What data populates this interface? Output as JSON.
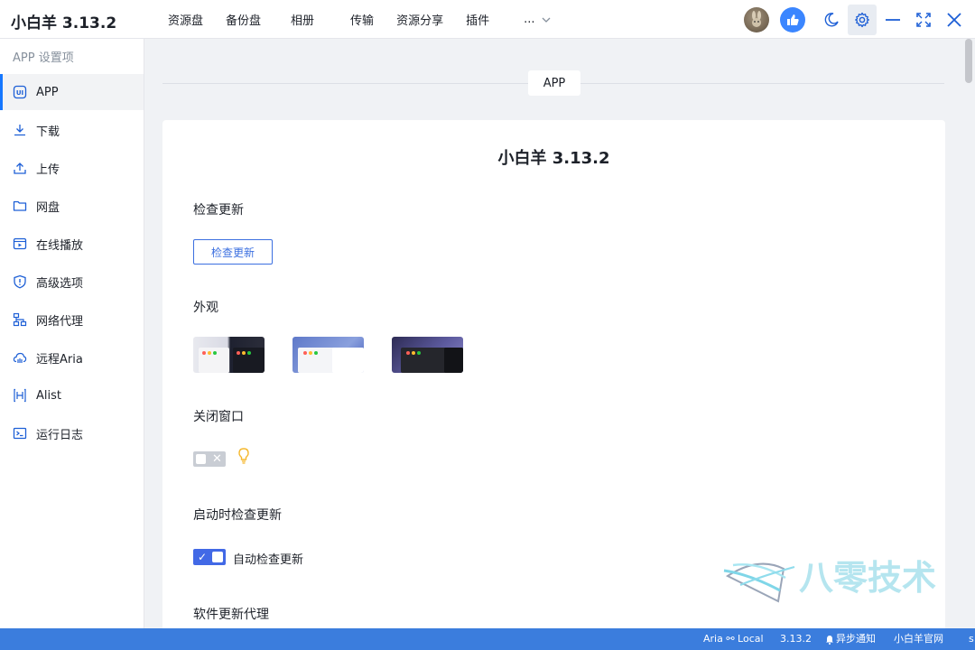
{
  "app": {
    "title": "小白羊 3.13.2"
  },
  "nav": {
    "tabs": [
      "资源盘",
      "备份盘",
      "相册",
      "传输",
      "资源分享",
      "插件"
    ],
    "more_label": "..."
  },
  "sidebar": {
    "heading": "APP 设置项",
    "items": [
      {
        "label": "APP",
        "icon": "app-icon",
        "active": true
      },
      {
        "label": "下载",
        "icon": "download-icon"
      },
      {
        "label": "上传",
        "icon": "upload-icon"
      },
      {
        "label": "网盘",
        "icon": "folder-icon"
      },
      {
        "label": "在线播放",
        "icon": "play-icon"
      },
      {
        "label": "高级选项",
        "icon": "shield-icon"
      },
      {
        "label": "网络代理",
        "icon": "network-icon"
      },
      {
        "label": "远程Aria",
        "icon": "cloud-icon"
      },
      {
        "label": "Alist",
        "icon": "alist-icon"
      },
      {
        "label": "运行日志",
        "icon": "terminal-icon"
      }
    ]
  },
  "main": {
    "section_label": "APP",
    "card_title": "小白羊 3.13.2",
    "check_update": {
      "label": "检查更新",
      "button": "检查更新"
    },
    "appearance": {
      "label": "外观",
      "themes": [
        "light-dark-split",
        "blue",
        "dark"
      ]
    },
    "close_window": {
      "label": "关闭窗口",
      "toggle_on": false
    },
    "startup_check": {
      "label": "启动时检查更新",
      "toggle_on": true,
      "toggle_label": "自动检查更新"
    },
    "update_proxy": {
      "label": "软件更新代理"
    }
  },
  "watermark": {
    "text": "八零技术"
  },
  "statusbar": {
    "aria": "Aria ⚯ Local",
    "version": "3.13.2",
    "notify": "异步通知",
    "site": "小白羊官网",
    "tail": "s"
  },
  "colors": {
    "accent": "#3b6fe0",
    "status_bar": "#3b7ddd",
    "toggle_on": "#4269e6",
    "toggle_off": "#c9cdd4"
  }
}
